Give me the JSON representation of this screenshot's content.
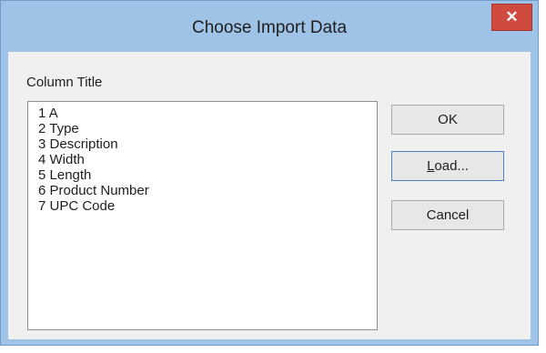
{
  "window": {
    "title": "Choose Import Data",
    "close_glyph": "✕"
  },
  "group": {
    "label": "Column Title"
  },
  "list": {
    "items": [
      {
        "num": "1",
        "name": "A"
      },
      {
        "num": "2",
        "name": "Type"
      },
      {
        "num": "3",
        "name": "Description"
      },
      {
        "num": "4",
        "name": "Width"
      },
      {
        "num": "5",
        "name": "Length"
      },
      {
        "num": "6",
        "name": "Product Number"
      },
      {
        "num": "7",
        "name": "UPC Code"
      }
    ]
  },
  "buttons": {
    "ok": "OK",
    "load_mnemonic": "L",
    "load_rest": "oad...",
    "cancel": "Cancel"
  },
  "colors": {
    "frame": "#9fc3e6",
    "close": "#cf4a3f",
    "client": "#f0f0f0"
  }
}
